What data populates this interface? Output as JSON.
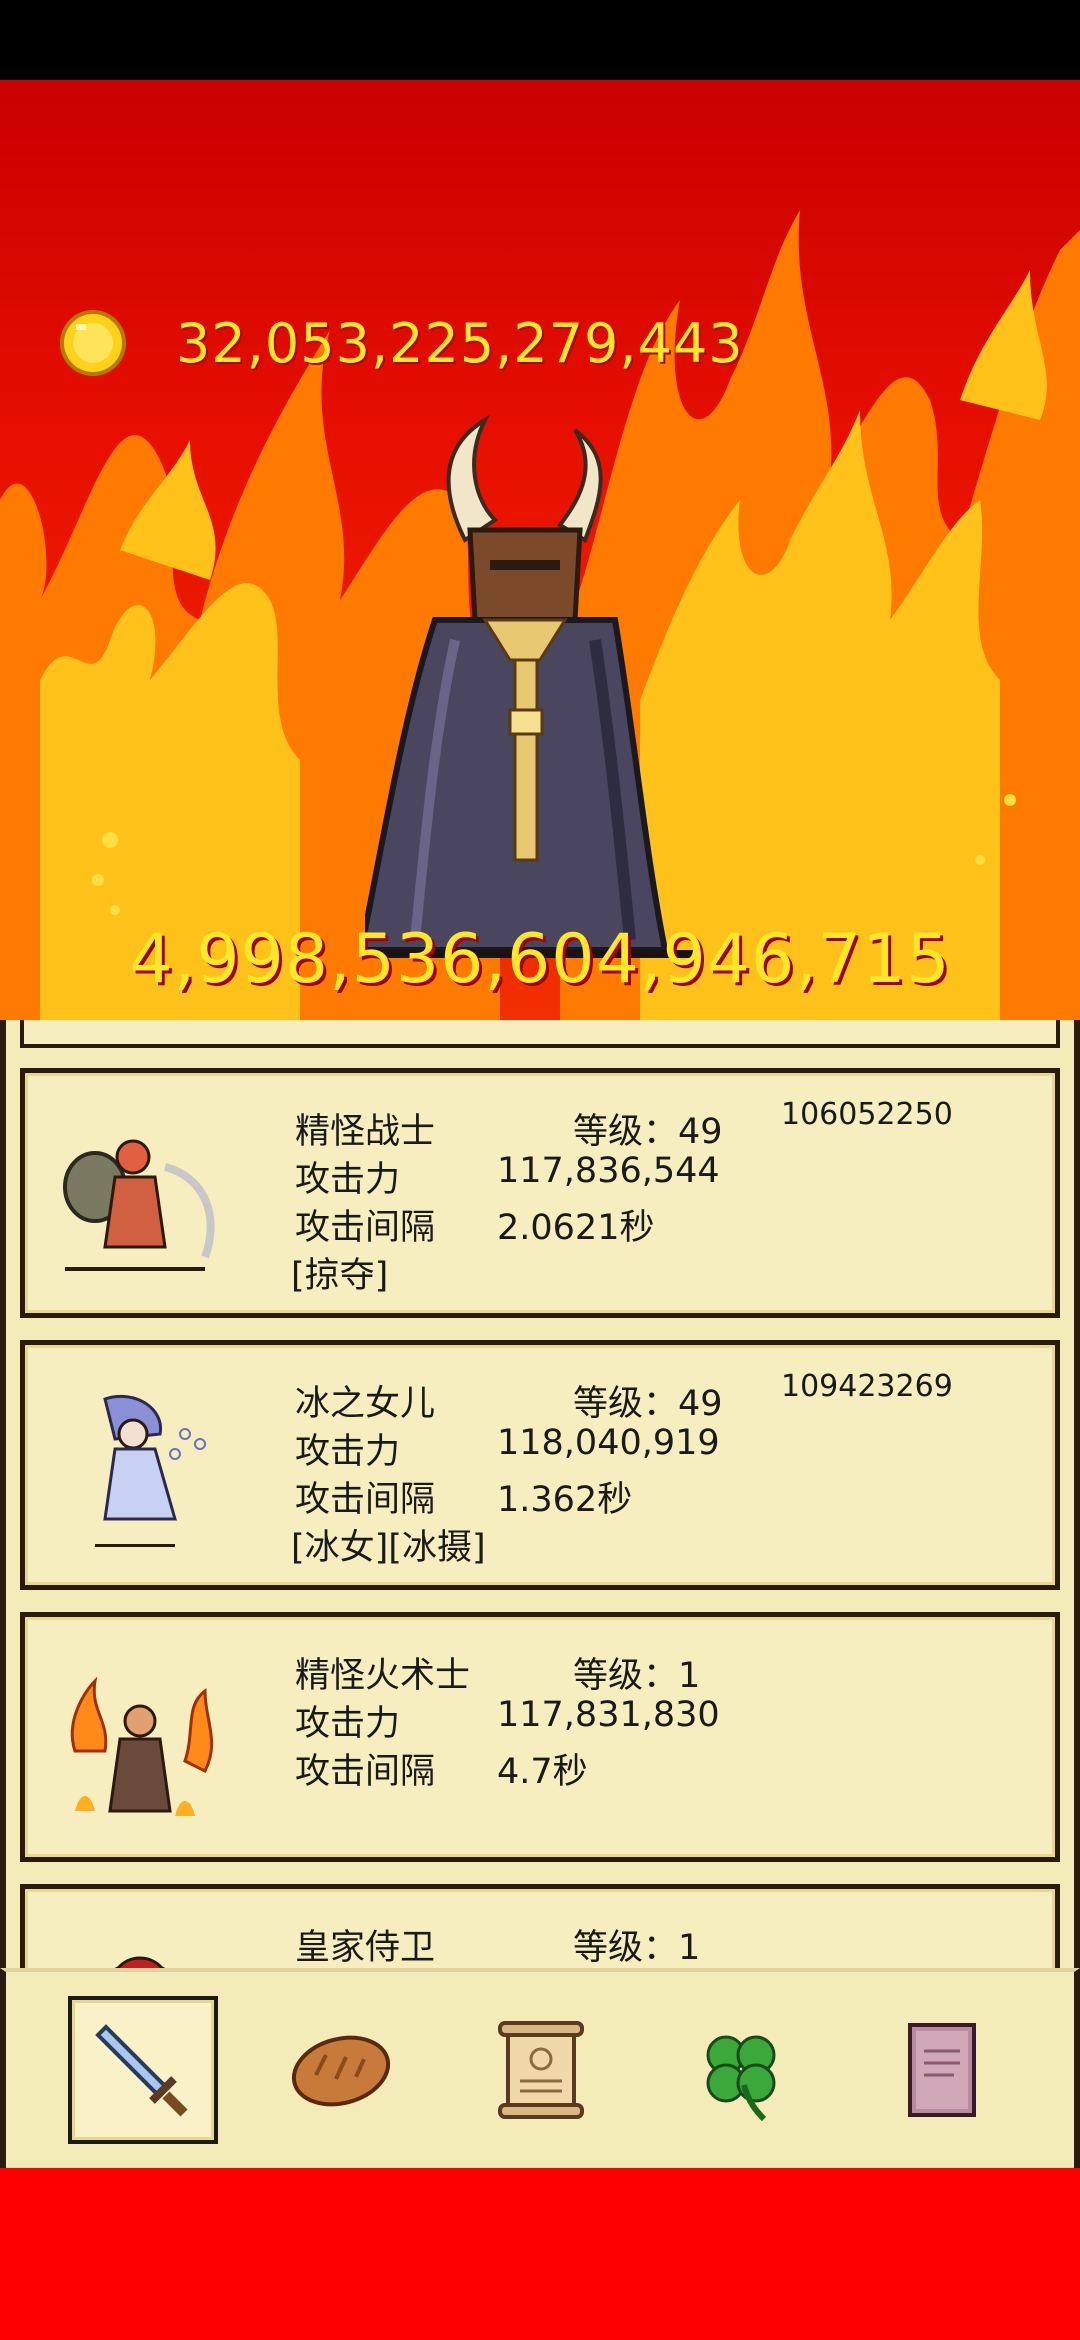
{
  "currency": {
    "icon": "gold-coin-icon",
    "amount": "32,053,225,279,443"
  },
  "boss": {
    "icon": "horned-cloaked-demon-boss",
    "hp": "4,998,536,604,946,715"
  },
  "heroes": [
    {
      "name": "精怪战士",
      "level": "等级：49",
      "id": "106052250",
      "attack_label": "攻击力",
      "attack": "117,836,544",
      "interval_label": "攻击间隔",
      "interval": "2.0621秒",
      "tags": "[掠夺]"
    },
    {
      "name": "冰之女儿",
      "level": "等级：49",
      "id": "109423269",
      "attack_label": "攻击力",
      "attack": "118,040,919",
      "interval_label": "攻击间隔",
      "interval": "1.362秒",
      "tags": "[冰女][冰摄]"
    },
    {
      "name": "精怪火术士",
      "level": "等级：1",
      "id": "",
      "attack_label": "攻击力",
      "attack": "117,831,830",
      "interval_label": "攻击间隔",
      "interval": "4.7秒",
      "tags": ""
    },
    {
      "name": "皇家侍卫",
      "level": "等级：1",
      "id": "",
      "attack_label": "",
      "attack": "",
      "interval_label": "",
      "interval": "",
      "tags": ""
    }
  ],
  "toolbar": {
    "tabs": [
      {
        "icon": "sword-icon",
        "active": true
      },
      {
        "icon": "bread-icon",
        "active": false
      },
      {
        "icon": "scroll-icon",
        "active": false
      },
      {
        "icon": "clover-icon",
        "active": false
      },
      {
        "icon": "book-icon",
        "active": false
      }
    ]
  },
  "colors": {
    "gold_text": "#ffe82a",
    "panel_bg": "#f4ecb8",
    "fire_red": "#e00000",
    "border": "#2a1a10"
  }
}
